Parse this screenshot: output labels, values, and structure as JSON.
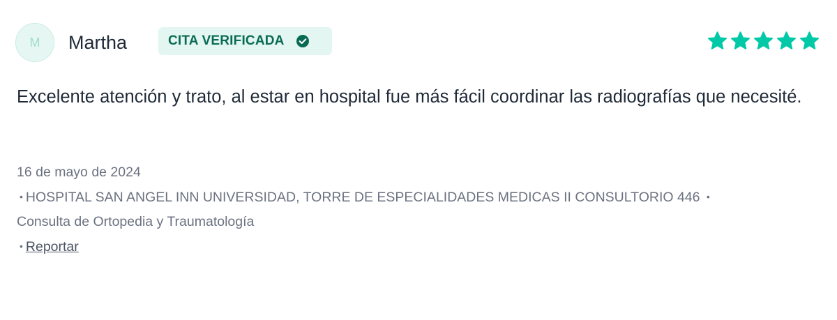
{
  "review": {
    "avatar_initial": "M",
    "author": "Martha",
    "badge": {
      "label": "CITA VERIFICADA",
      "icon": "check-circle-icon"
    },
    "rating": 5,
    "rating_max": 5,
    "comment": "Excelente atención y trato, al estar en hospital fue más fácil coordinar las radiografías que necesité.",
    "date": "16 de mayo de 2024",
    "location": "HOSPITAL SAN ANGEL INN UNIVERSIDAD, TORRE DE ESPECIALIDADES MEDICAS II CONSULTORIO 446",
    "service": "Consulta de Ortopedia y Traumatología",
    "bullet": "•",
    "report_label": "Reportar"
  },
  "colors": {
    "accent": "#00c9a7",
    "badge_bg": "#e3f6f1",
    "badge_text": "#0a6b55",
    "text_primary": "#1f2a37",
    "text_secondary": "#6b7280"
  }
}
